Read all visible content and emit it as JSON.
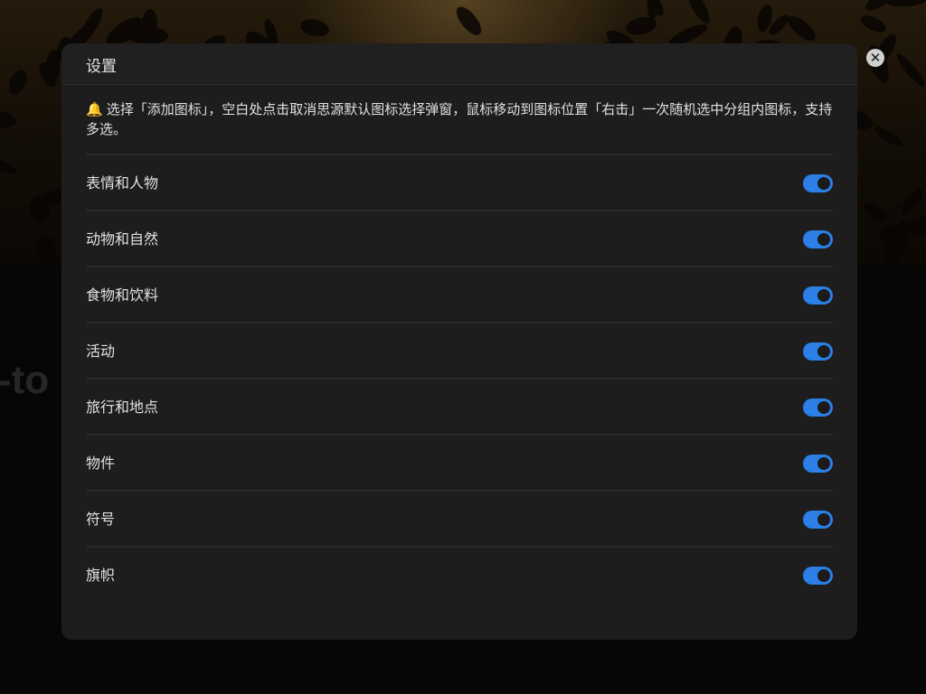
{
  "background": {
    "partial_text": "-to"
  },
  "dialog": {
    "title": "设置",
    "tip_icon": "🔔",
    "tip_text": "选择「添加图标」，空白处点击取消思源默认图标选择弹窗，鼠标移动到图标位置「右击」一次随机选中分组内图标，支持多选。",
    "close_icon": "✕",
    "categories": [
      {
        "label": "表情和人物",
        "enabled": true
      },
      {
        "label": "动物和自然",
        "enabled": true
      },
      {
        "label": "食物和饮料",
        "enabled": true
      },
      {
        "label": "活动",
        "enabled": true
      },
      {
        "label": "旅行和地点",
        "enabled": true
      },
      {
        "label": "物件",
        "enabled": true
      },
      {
        "label": "符号",
        "enabled": true
      },
      {
        "label": "旗帜",
        "enabled": true
      }
    ]
  },
  "colors": {
    "toggle_on": "#2b7fe6",
    "dialog_bg": "#1d1d1e"
  }
}
